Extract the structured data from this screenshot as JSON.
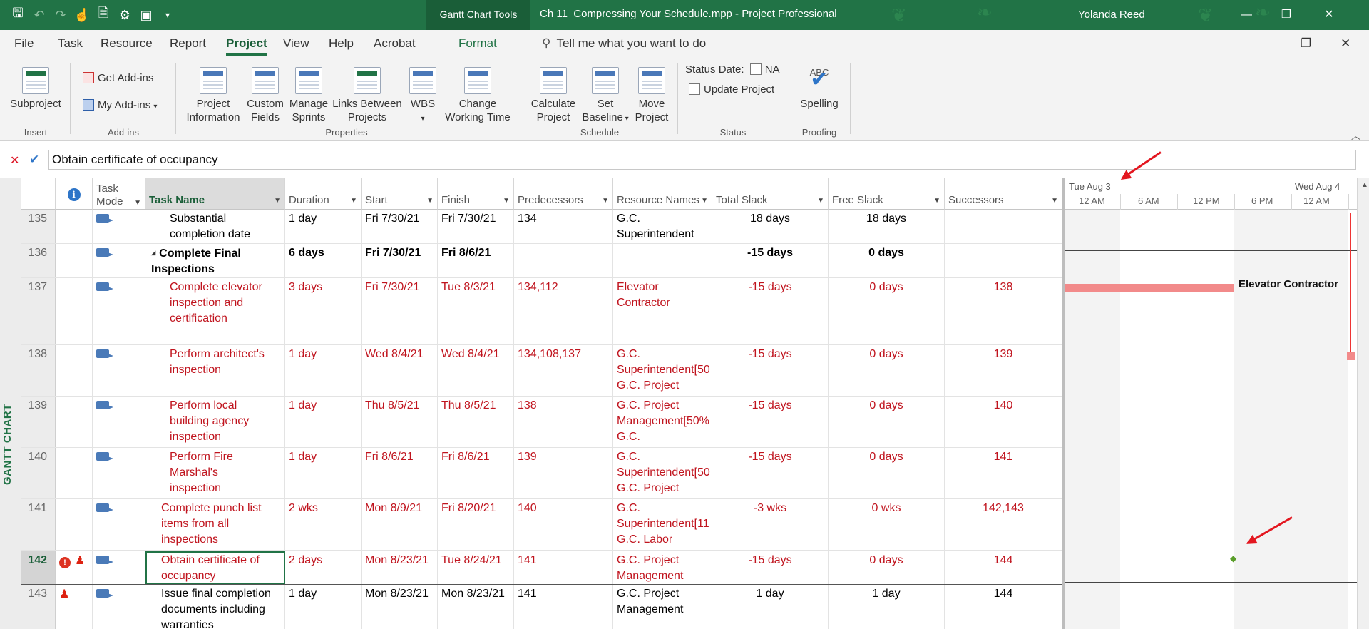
{
  "titlebar": {
    "context_tools": "Gantt Chart Tools",
    "document_title": "Ch 11_Compressing Your Schedule.mpp  -  Project Professional",
    "user": "Yolanda Reed"
  },
  "tabs": [
    "File",
    "Task",
    "Resource",
    "Report",
    "Project",
    "View",
    "Help",
    "Acrobat",
    "Format"
  ],
  "active_tab": "Project",
  "tell_me": "Tell me what you want to do",
  "ribbon": {
    "insert": {
      "subproject": "Subproject",
      "group": "Insert"
    },
    "addins": {
      "get": "Get Add-ins",
      "my": "My Add-ins",
      "group": "Add-ins"
    },
    "properties": {
      "project_information": [
        "Project",
        "Information"
      ],
      "custom_fields": [
        "Custom",
        "Fields"
      ],
      "manage_sprints": [
        "Manage",
        "Sprints"
      ],
      "links_between_projects": [
        "Links Between",
        "Projects"
      ],
      "wbs": "WBS",
      "change_working_time": [
        "Change",
        "Working Time"
      ],
      "group": "Properties"
    },
    "schedule": {
      "calculate": [
        "Calculate",
        "Project"
      ],
      "set_baseline": [
        "Set",
        "Baseline"
      ],
      "move_project": [
        "Move",
        "Project"
      ],
      "group": "Schedule"
    },
    "status": {
      "status_date_label": "Status Date:",
      "status_date_value": "NA",
      "update_project": "Update Project",
      "group": "Status"
    },
    "proofing": {
      "spelling": "Spelling",
      "group": "Proofing"
    }
  },
  "entry_bar": {
    "value": "Obtain certificate of occupancy"
  },
  "view_bar": "GANTT CHART",
  "columns": {
    "mode": [
      "Task",
      "Mode"
    ],
    "name": "Task Name",
    "duration": "Duration",
    "start": "Start",
    "finish": "Finish",
    "predecessors": "Predecessors",
    "resources": "Resource Names",
    "total_slack": "Total Slack",
    "free_slack": "Free Slack",
    "successors": "Successors"
  },
  "rows": [
    {
      "id": "135",
      "name": [
        "Substantial",
        "completion date"
      ],
      "duration": "1 day",
      "start": "Fri 7/30/21",
      "finish": "Fri 7/30/21",
      "pred": "134",
      "res": [
        "G.C.",
        "Superintendent"
      ],
      "tslack": "18 days",
      "fslack": "18 days",
      "succ": ""
    },
    {
      "id": "136",
      "name": [
        "Complete Final",
        "Inspections"
      ],
      "duration": "6 days",
      "start": "Fri 7/30/21",
      "finish": "Fri 8/6/21",
      "pred": "",
      "res": [],
      "tslack": "-15 days",
      "fslack": "0 days",
      "succ": ""
    },
    {
      "id": "137",
      "name": [
        "Complete elevator",
        "inspection and",
        "certification"
      ],
      "duration": "3 days",
      "start": "Fri 7/30/21",
      "finish": "Tue 8/3/21",
      "pred": "134,112",
      "res": [
        "Elevator",
        "Contractor"
      ],
      "tslack": "-15 days",
      "fslack": "0 days",
      "succ": "138"
    },
    {
      "id": "138",
      "name": [
        "Perform architect's",
        "inspection"
      ],
      "duration": "1 day",
      "start": "Wed 8/4/21",
      "finish": "Wed 8/4/21",
      "pred": "134,108,137",
      "res": [
        "G.C.",
        "Superintendent[50",
        "G.C. Project"
      ],
      "tslack": "-15 days",
      "fslack": "0 days",
      "succ": "139"
    },
    {
      "id": "139",
      "name": [
        "Perform local",
        "building agency",
        "inspection"
      ],
      "duration": "1 day",
      "start": "Thu 8/5/21",
      "finish": "Thu 8/5/21",
      "pred": "138",
      "res": [
        "G.C. Project",
        "Management[50%",
        "G.C."
      ],
      "tslack": "-15 days",
      "fslack": "0 days",
      "succ": "140"
    },
    {
      "id": "140",
      "name": [
        "Perform Fire",
        "Marshal's",
        "inspection"
      ],
      "duration": "1 day",
      "start": "Fri 8/6/21",
      "finish": "Fri 8/6/21",
      "pred": "139",
      "res": [
        "G.C.",
        "Superintendent[50",
        "G.C. Project"
      ],
      "tslack": "-15 days",
      "fslack": "0 days",
      "succ": "141"
    },
    {
      "id": "141",
      "name": [
        "Complete punch list",
        "items from all",
        "inspections"
      ],
      "duration": "2 wks",
      "start": "Mon 8/9/21",
      "finish": "Fri 8/20/21",
      "pred": "140",
      "res": [
        "G.C.",
        "Superintendent[11",
        "G.C. Labor"
      ],
      "tslack": "-3 wks",
      "fslack": "0 wks",
      "succ": "142,143"
    },
    {
      "id": "142",
      "name": [
        "Obtain certificate of",
        "occupancy"
      ],
      "duration": "2 days",
      "start": "Mon 8/23/21",
      "finish": "Tue 8/24/21",
      "pred": "141",
      "res": [
        "G.C. Project",
        "Management"
      ],
      "tslack": "-15 days",
      "fslack": "0 days",
      "succ": "144"
    },
    {
      "id": "143",
      "name": [
        "Issue final completion",
        "documents including",
        "warranties"
      ],
      "duration": "1 day",
      "start": "Mon 8/23/21",
      "finish": "Mon 8/23/21",
      "pred": "141",
      "res": [
        "G.C. Project",
        "Management"
      ],
      "tslack": "1 day",
      "fslack": "1 day",
      "succ": "144"
    }
  ],
  "gantt": {
    "top_labels": [
      "Tue Aug 3",
      "Wed Aug 4"
    ],
    "bottom_labels": [
      "12 AM",
      "6 AM",
      "12 PM",
      "6 PM",
      "12 AM"
    ],
    "bar_label_137": "Elevator Contractor"
  },
  "colors": {
    "accent": "#217346",
    "critical": "#c0141e",
    "critical_bar": "#f28a8a",
    "annotation": "#e3161f"
  }
}
